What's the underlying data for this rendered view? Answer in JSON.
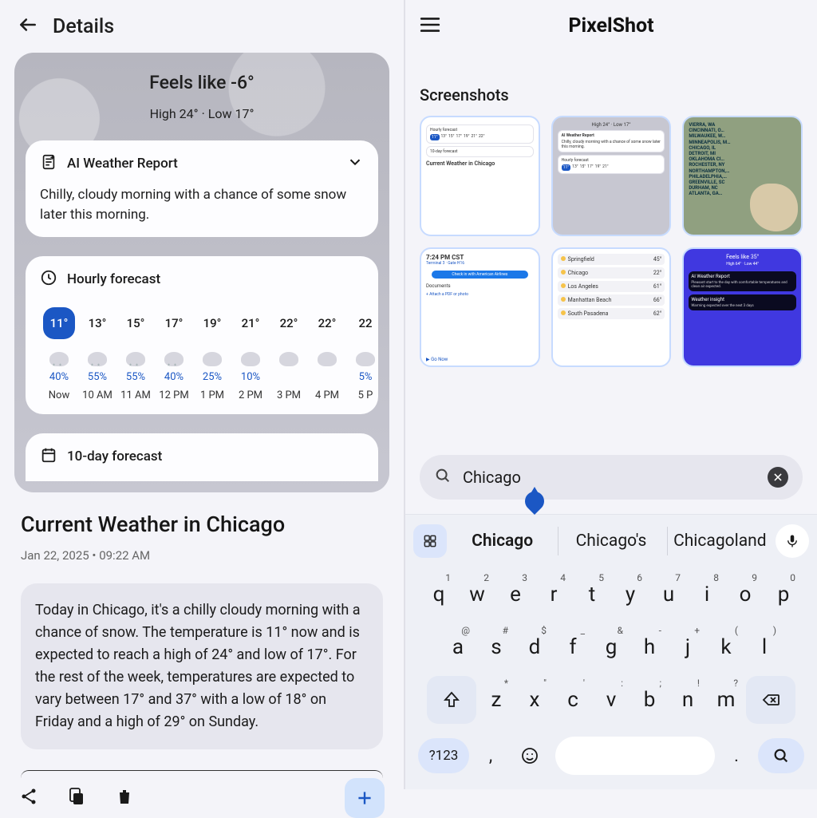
{
  "left": {
    "header": {
      "title": "Details"
    },
    "hero": {
      "feels_like": "Feels like -6°",
      "highlow": "High 24° · Low 17°"
    },
    "ai": {
      "title": "AI Weather Report",
      "body": "Chilly, cloudy morning with a chance of some snow later this morning."
    },
    "hourly": {
      "title": "Hourly forecast",
      "cols": [
        {
          "temp": "11°",
          "precip": "40%",
          "label": "Now",
          "active": true,
          "snow": true
        },
        {
          "temp": "13°",
          "precip": "55%",
          "label": "10 AM",
          "active": false,
          "snow": true
        },
        {
          "temp": "15°",
          "precip": "55%",
          "label": "11 AM",
          "active": false,
          "snow": true
        },
        {
          "temp": "17°",
          "precip": "40%",
          "label": "12 PM",
          "active": false,
          "snow": true
        },
        {
          "temp": "19°",
          "precip": "25%",
          "label": "1 PM",
          "active": false,
          "snow": false
        },
        {
          "temp": "21°",
          "precip": "10%",
          "label": "2 PM",
          "active": false,
          "snow": false
        },
        {
          "temp": "22°",
          "precip": "",
          "label": "3 PM",
          "active": false,
          "snow": false
        },
        {
          "temp": "22°",
          "precip": "",
          "label": "4 PM",
          "active": false,
          "snow": false
        },
        {
          "temp": "22",
          "precip": "5%",
          "label": "5 P",
          "active": false,
          "snow": false
        }
      ]
    },
    "tenday": {
      "title": "10-day forecast"
    },
    "article": {
      "title": "Current Weather in Chicago",
      "timestamp": "Jan 22, 2025 • 09:22 AM",
      "summary": "Today in Chicago, it's a chilly cloudy morning with a chance of snow. The temperature is 11° now and is expected to reach a high of 24° and low of 17°. For the rest of the week, temperatures are expected to vary between 17° and 37° with a low of 18° on Friday and a high of 29° on Sunday."
    }
  },
  "right": {
    "app_title": "PixelShot",
    "section": "Screenshots",
    "thumbs": {
      "t1": {
        "ai_title": "Hourly forecast",
        "ten": "10-day forecast",
        "caption": "Current Weather in Chicago"
      },
      "t2": {
        "hl": "High 24° · Low 17°",
        "ai": "AI Weather Report",
        "body": "Chilly, cloudy morning with a chance of some snow later this morning.",
        "hf": "Hourly forecast"
      },
      "t3": {
        "lines": [
          "VIERRA, WA",
          "CINCINNATI, O…",
          "MILWAUKEE, W…",
          "MINNEAPOLIS, M…",
          "CHICAGO, IL",
          "DETROIT, MI",
          "OKLAHOMA CI…",
          "ROCHESTER, NY",
          "NORTHAMPTON,…",
          "PHILADELPHIA,…",
          "GREENVILLE, SC",
          "DURHAM, NC",
          "ATLANTA, GA…"
        ]
      },
      "t4": {
        "time": "7:24 PM CST",
        "sub": "Terminal 3 · Gate H16",
        "btn": "Check in with American Airlines",
        "docs": "Documents",
        "attach": "Attach a PDF or photo",
        "go": "Go Now"
      },
      "t5": {
        "rows": [
          {
            "city": "Springfield",
            "t": "45°"
          },
          {
            "city": "Chicago",
            "t": "22°"
          },
          {
            "city": "Los Angeles",
            "t": "61°"
          },
          {
            "city": "Manhattan Beach",
            "t": "66°"
          },
          {
            "city": "South Pasadena",
            "t": "62°"
          }
        ]
      },
      "t6": {
        "feels": "Feels like 35°",
        "hl": "High 64° · Low 44°",
        "ai": "AI Weather Report",
        "ai_body": "Pleasant start to the day with comfortable temperatures and clean air expected.",
        "insight": "Weather insight",
        "insight_body": "Warming expected over the next 3 days"
      }
    },
    "search": {
      "value": "Chicago"
    },
    "suggestions": [
      "Chicago",
      "Chicago's",
      "Chicagoland"
    ],
    "keyboard": {
      "r1": [
        {
          "k": "q",
          "h": "1"
        },
        {
          "k": "w",
          "h": "2"
        },
        {
          "k": "e",
          "h": "3"
        },
        {
          "k": "r",
          "h": "4"
        },
        {
          "k": "t",
          "h": "5"
        },
        {
          "k": "y",
          "h": "6"
        },
        {
          "k": "u",
          "h": "7"
        },
        {
          "k": "i",
          "h": "8"
        },
        {
          "k": "o",
          "h": "9"
        },
        {
          "k": "p",
          "h": "0"
        }
      ],
      "r2": [
        {
          "k": "a",
          "h": "@"
        },
        {
          "k": "s",
          "h": "#"
        },
        {
          "k": "d",
          "h": "$"
        },
        {
          "k": "f",
          "h": "_"
        },
        {
          "k": "g",
          "h": "&"
        },
        {
          "k": "h",
          "h": "-"
        },
        {
          "k": "j",
          "h": "+"
        },
        {
          "k": "k",
          "h": "("
        },
        {
          "k": "l",
          "h": ")"
        }
      ],
      "r3": [
        {
          "k": "z",
          "h": "*"
        },
        {
          "k": "x",
          "h": "\""
        },
        {
          "k": "c",
          "h": "'"
        },
        {
          "k": "v",
          "h": ":"
        },
        {
          "k": "b",
          "h": ";"
        },
        {
          "k": "n",
          "h": "!"
        },
        {
          "k": "m",
          "h": "?"
        }
      ],
      "sym": "?123",
      "comma": ",",
      "period": "."
    }
  }
}
